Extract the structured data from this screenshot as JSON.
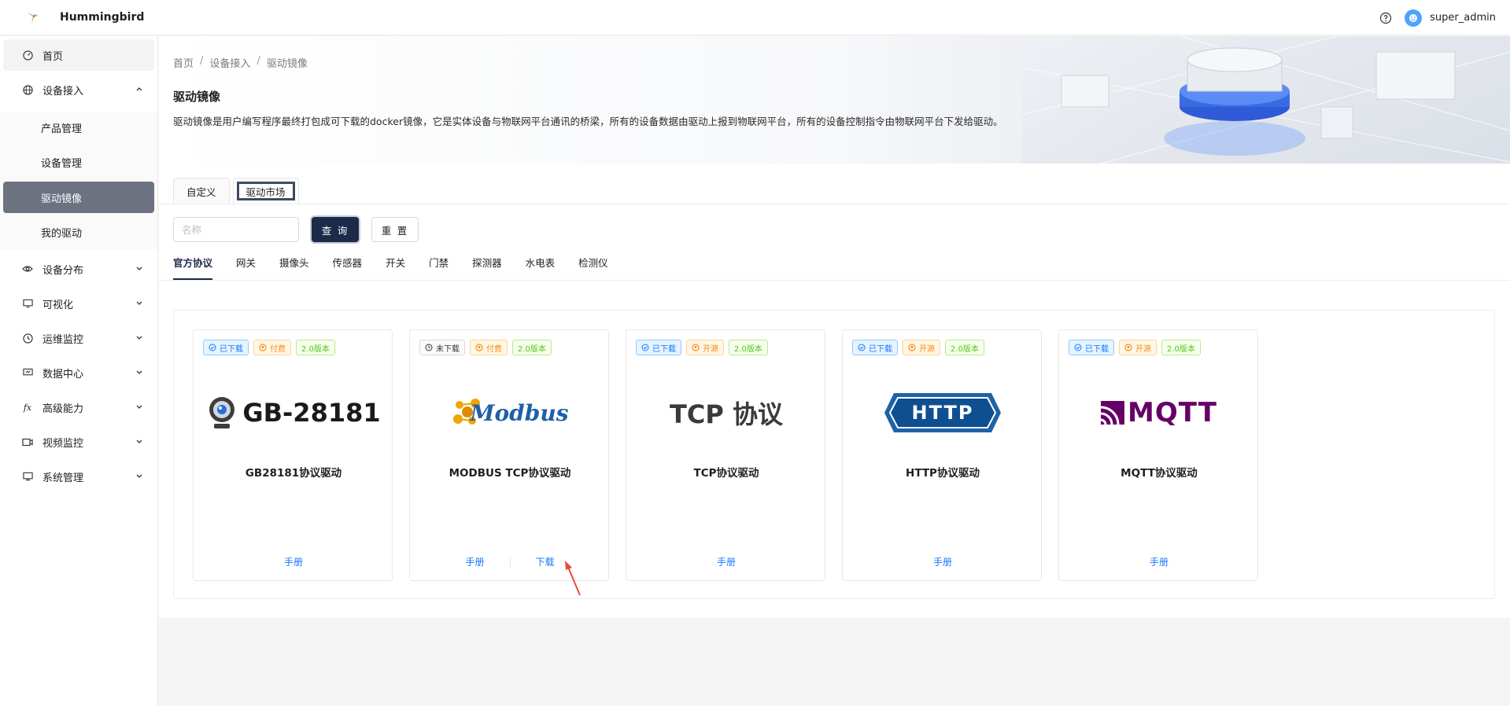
{
  "app": {
    "title": "Hummingbird",
    "user": "super_admin"
  },
  "sidebar": {
    "home": "首页",
    "device_access": "设备接入",
    "sub": [
      "产品管理",
      "设备管理",
      "驱动镜像",
      "我的驱动"
    ],
    "items": [
      "设备分布",
      "可视化",
      "运维监控",
      "数据中心",
      "高级能力",
      "视频监控",
      "系统管理"
    ]
  },
  "breadcrumb": [
    "首页",
    "设备接入",
    "驱动镜像"
  ],
  "page": {
    "title": "驱动镜像",
    "desc": "驱动镜像是用户编写程序最终打包成可下载的docker镜像，它是实体设备与物联网平台通讯的桥梁，所有的设备数据由驱动上报到物联网平台，所有的设备控制指令由物联网平台下发给驱动。"
  },
  "tabs": [
    "自定义",
    "驱动市场"
  ],
  "search": {
    "placeholder": "名称",
    "query": "查 询",
    "reset": "重 置"
  },
  "categories": [
    "官方协议",
    "网关",
    "摄像头",
    "传感器",
    "开关",
    "门禁",
    "探测器",
    "水电表",
    "检测仪"
  ],
  "cards": [
    {
      "status": "已下载",
      "price": "付费",
      "version": "2.0版本",
      "logo_text": "GB-28181",
      "title": "GB28181协议驱动",
      "manual": "手册"
    },
    {
      "status": "未下载",
      "price": "付费",
      "version": "2.0版本",
      "logo_text": "Modbus",
      "title": "MODBUS TCP协议驱动",
      "manual": "手册",
      "download": "下载"
    },
    {
      "status": "已下载",
      "price": "开源",
      "version": "2.0版本",
      "logo_text": "TCP 协议",
      "title": "TCP协议驱动",
      "manual": "手册"
    },
    {
      "status": "已下载",
      "price": "开源",
      "version": "2.0版本",
      "logo_text": "HTTP",
      "title": "HTTP协议驱动",
      "manual": "手册"
    },
    {
      "status": "已下载",
      "price": "开源",
      "version": "2.0版本",
      "logo_text": "MQTT",
      "title": "MQTT协议驱动",
      "manual": "手册"
    }
  ],
  "colors": {
    "accent": "#1c2b4a",
    "link": "#1677ff",
    "active_menu": "#6c7280",
    "annotation_arrow": "#e84a3c"
  }
}
